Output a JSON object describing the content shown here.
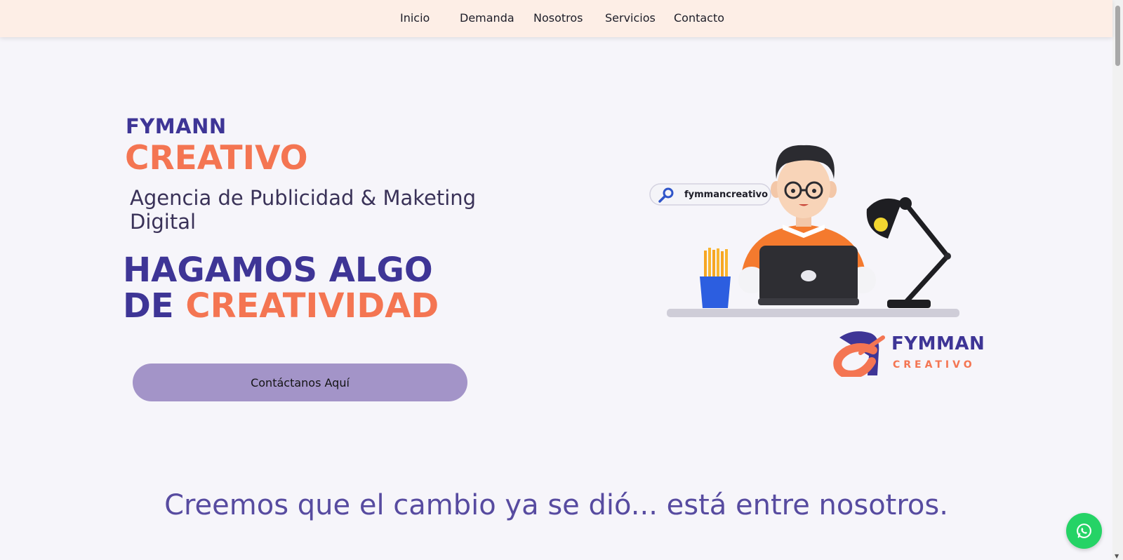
{
  "nav": {
    "items": [
      {
        "label": "Inicio"
      },
      {
        "label": "Demanda"
      },
      {
        "label": "Nosotros"
      },
      {
        "label": "Servicios"
      },
      {
        "label": "Contacto"
      }
    ]
  },
  "hero": {
    "brand_top": "FYMANN",
    "brand_big": "CREATIVO",
    "tagline": "Agencia de Publicidad & Maketing Digital",
    "headline_line1": "HAGAMOS ALGO",
    "headline_line2_prefix": "DE",
    "headline_line2_accent": "CREATIVIDAD",
    "cta_label": "Contáctanos Aquí"
  },
  "illustration": {
    "search_text": "fymmancreativo"
  },
  "logo": {
    "word": "FYMMAN",
    "sub": "CREATIVO"
  },
  "section": {
    "heading": "Creemos que el cambio ya se dió... está entre nosotros."
  },
  "colors": {
    "primary": "#3e3596",
    "accent": "#f47552",
    "nav_bg": "#fdeee6",
    "cta_bg": "#a394c8",
    "whatsapp": "#25d366"
  },
  "icons": {
    "search": "search-icon",
    "whatsapp": "whatsapp-icon"
  }
}
